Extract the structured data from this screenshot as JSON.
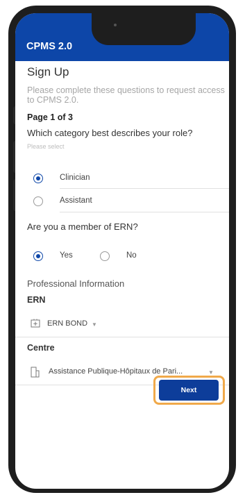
{
  "app": {
    "title": "CPMS 2.0"
  },
  "form": {
    "title": "Sign Up",
    "subtitle": "Please complete these questions to request access to CPMS 2.0.",
    "page_indicator": "Page 1 of 3",
    "role_question": "Which category best describes your role?",
    "role_hint": "Please select",
    "role_options": [
      {
        "label": "Clinician",
        "selected": true
      },
      {
        "label": "Assistant",
        "selected": false
      }
    ],
    "ern_question": "Are you a member of ERN?",
    "ern_options": [
      {
        "label": "Yes",
        "selected": true
      },
      {
        "label": "No",
        "selected": false
      }
    ],
    "professional_section": "Professional Information",
    "ern_label": "ERN",
    "ern_value": "ERN BOND",
    "centre_label": "Centre",
    "centre_value": "Assistance Publique-Hôpitaux de Pari...",
    "next_label": "Next"
  },
  "colors": {
    "primary": "#0d46a8",
    "highlight": "#f0a94a"
  },
  "icons": {
    "ern": "hospital-cross-icon",
    "centre": "building-icon",
    "dropdown": "chevron-down-icon"
  }
}
